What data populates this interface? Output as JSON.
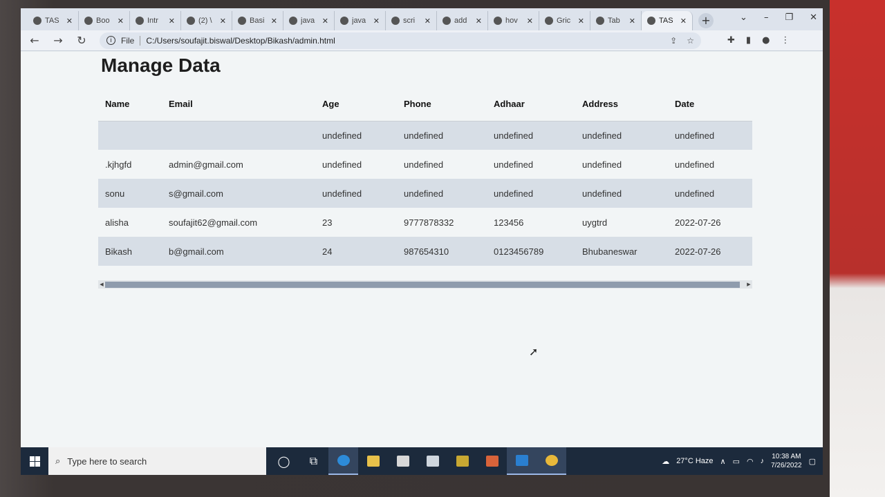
{
  "browser": {
    "tabs": [
      {
        "title": "TAS",
        "icon": "globe-icon"
      },
      {
        "title": "Boo",
        "icon": "book-icon"
      },
      {
        "title": "Intr",
        "icon": "bootstrap-icon"
      },
      {
        "title": "(2) \\",
        "icon": "whatsapp-icon"
      },
      {
        "title": "Basi",
        "icon": "globe-icon"
      },
      {
        "title": "java",
        "icon": "github-icon"
      },
      {
        "title": "java",
        "icon": "github-icon"
      },
      {
        "title": "scri",
        "icon": "globe-icon"
      },
      {
        "title": "add",
        "icon": "code-icon"
      },
      {
        "title": "hov",
        "icon": "google-icon"
      },
      {
        "title": "Gric",
        "icon": "bootstrap-icon"
      },
      {
        "title": "Tab",
        "icon": "bootstrap-icon"
      },
      {
        "title": "TAS",
        "icon": "globe-icon",
        "active": true
      }
    ],
    "new_tab_label": "+",
    "address_scheme": "File",
    "address_url": "C:/Users/soufajit.biswal/Desktop/Bikash/admin.html"
  },
  "page": {
    "title": "Manage Data",
    "columns": [
      "Name",
      "Email",
      "Age",
      "Phone",
      "Adhaar",
      "Address",
      "Date"
    ],
    "rows": [
      [
        "",
        "",
        "undefined",
        "undefined",
        "undefined",
        "undefined",
        "undefined"
      ],
      [
        ".kjhgfd",
        "admin@gmail.com",
        "undefined",
        "undefined",
        "undefined",
        "undefined",
        "undefined"
      ],
      [
        "sonu",
        "s@gmail.com",
        "undefined",
        "undefined",
        "undefined",
        "undefined",
        "undefined"
      ],
      [
        "alisha",
        "soufajit62@gmail.com",
        "23",
        "9777878332",
        "123456",
        "uygtrd",
        "2022-07-26"
      ],
      [
        "Bikash",
        "b@gmail.com",
        "24",
        "987654310",
        "0123456789",
        "Bhubaneswar",
        "2022-07-26"
      ]
    ]
  },
  "taskbar": {
    "search_placeholder": "Type here to search",
    "weather": "27°C  Haze",
    "time": "10:38 AM",
    "date": "7/26/2022"
  },
  "colors": {
    "row_alt": "#d7dee6",
    "taskbar": "#1c2a3c",
    "scroll_thumb": "#8f9cad"
  }
}
